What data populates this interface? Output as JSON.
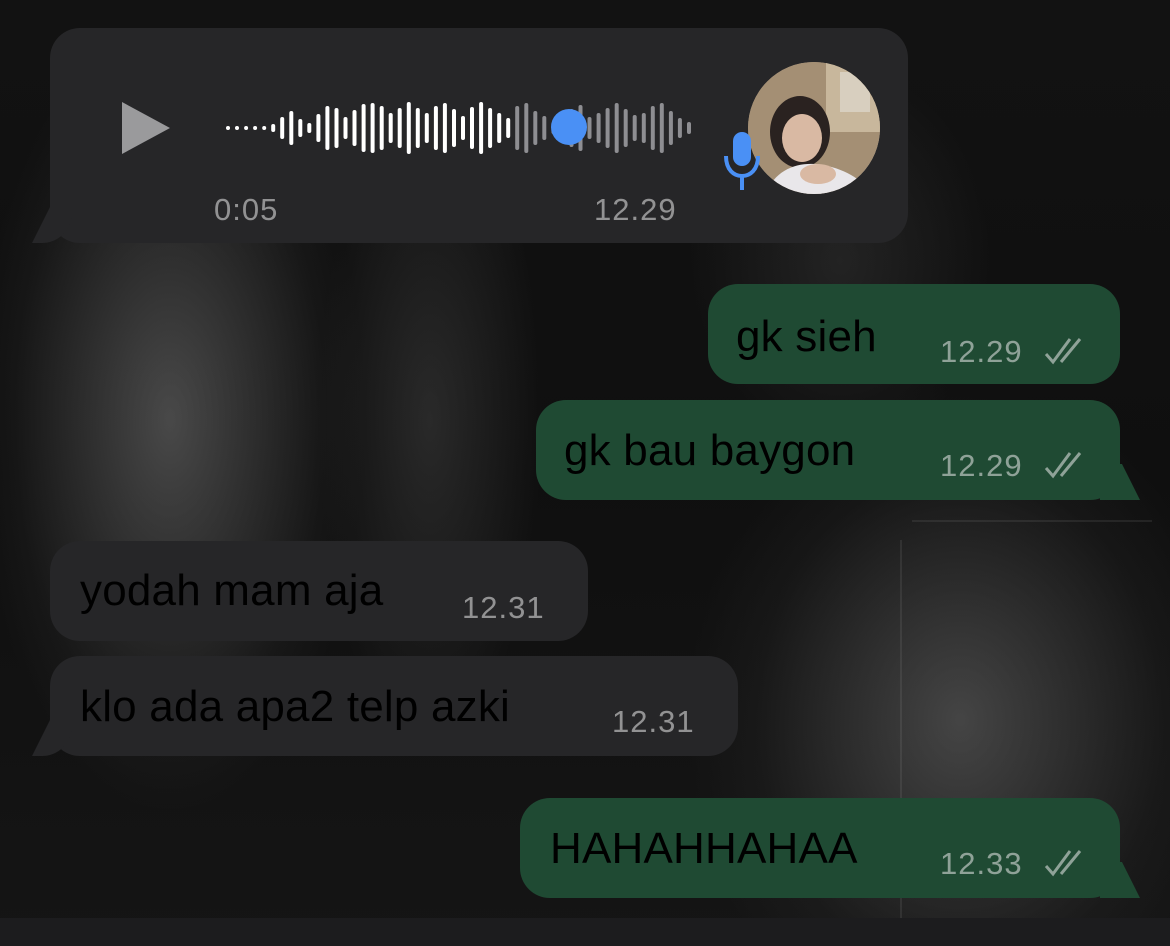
{
  "colors": {
    "incoming_bubble": "#262628",
    "outgoing_bubble": "#1f4a33",
    "accent_blue": "#4a90f5",
    "text": "#ffffff"
  },
  "voice_message": {
    "direction": "incoming",
    "duration": "0:05",
    "time": "12.29",
    "playback_progress": 0.6,
    "play_icon": "play-icon",
    "mic_icon": "mic-icon"
  },
  "messages": [
    {
      "direction": "outgoing",
      "text": "gk sieh",
      "time": "12.29",
      "status_icon": "double-check-icon"
    },
    {
      "direction": "outgoing",
      "text": "gk bau baygon",
      "time": "12.29",
      "status_icon": "double-check-icon"
    },
    {
      "direction": "incoming",
      "text": "yodah mam aja",
      "time": "12.31"
    },
    {
      "direction": "incoming",
      "text": "klo ada apa2 telp azki",
      "time": "12.31"
    },
    {
      "direction": "outgoing",
      "text": "HAHAHHAHAA",
      "time": "12.33",
      "status_icon": "double-check-icon"
    }
  ]
}
